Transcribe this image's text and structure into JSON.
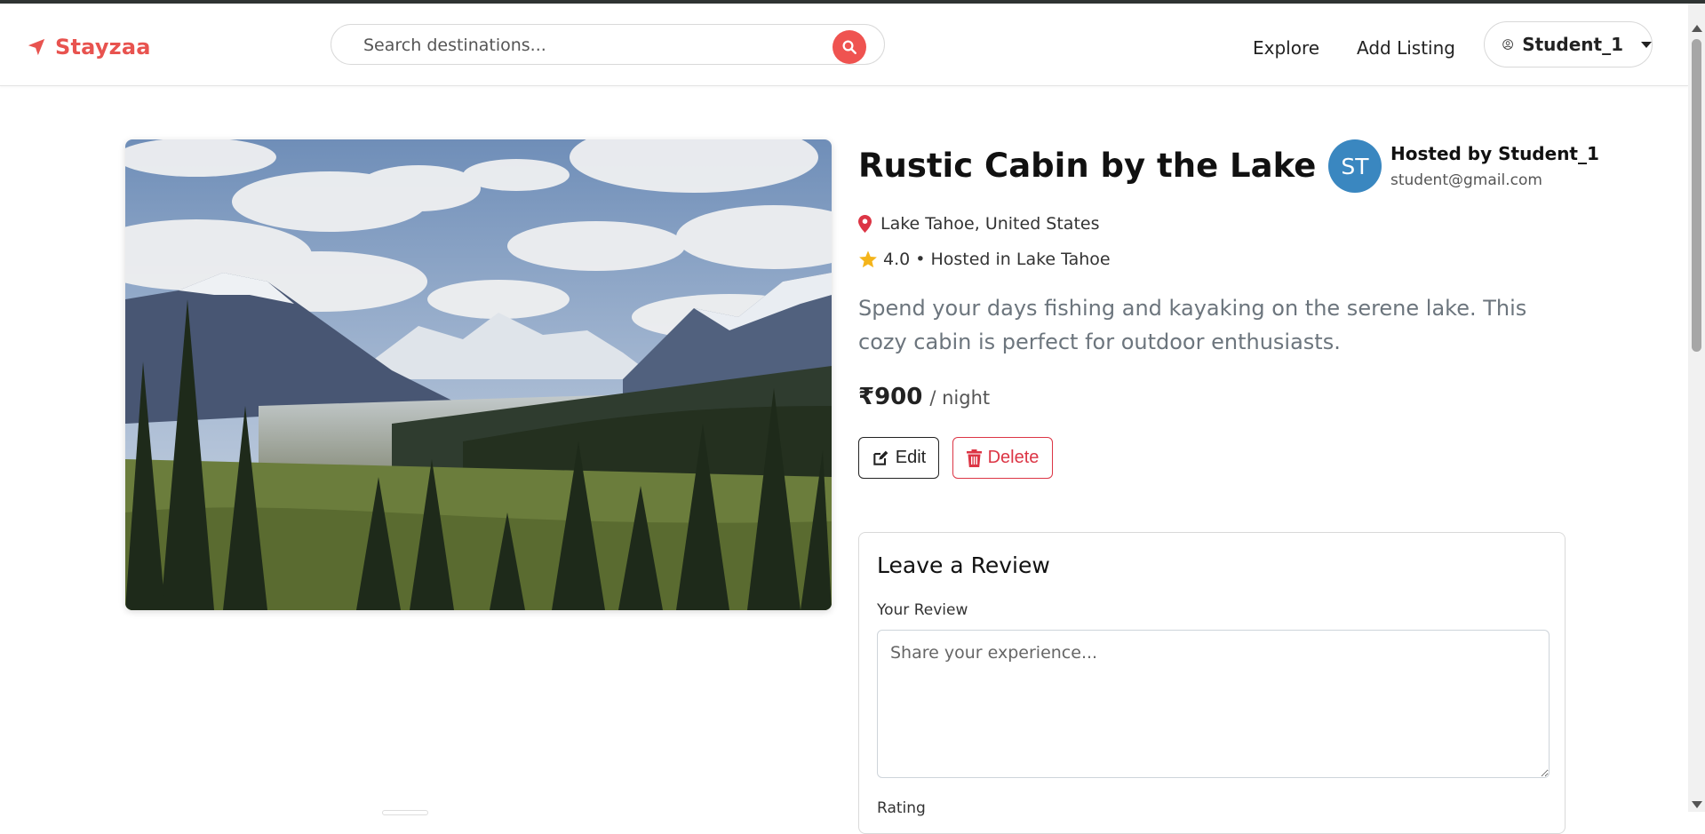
{
  "app": {
    "brand": "Stayzaa",
    "accent": "#e8534f"
  },
  "search": {
    "placeholder": "Search destinations..."
  },
  "nav": {
    "explore": "Explore",
    "add_listing": "Add Listing",
    "user": "Student_1"
  },
  "listing": {
    "title": "Rustic Cabin by the Lake",
    "location": "Lake Tahoe, United States",
    "rating": "4.0",
    "hosted_in": "• Hosted in Lake Tahoe",
    "description": "Spend your days fishing and kayaking on the serene lake. This cozy cabin is perfect for outdoor enthusiasts.",
    "price": "₹900",
    "price_unit": "/ night",
    "host": {
      "initials": "ST",
      "name": "Hosted by Student_1",
      "email": "student@gmail.com"
    }
  },
  "actions": {
    "edit": "Edit",
    "delete": "Delete"
  },
  "review": {
    "heading": "Leave a Review",
    "label": "Your Review",
    "placeholder": "Share your experience...",
    "rating_label": "Rating"
  }
}
